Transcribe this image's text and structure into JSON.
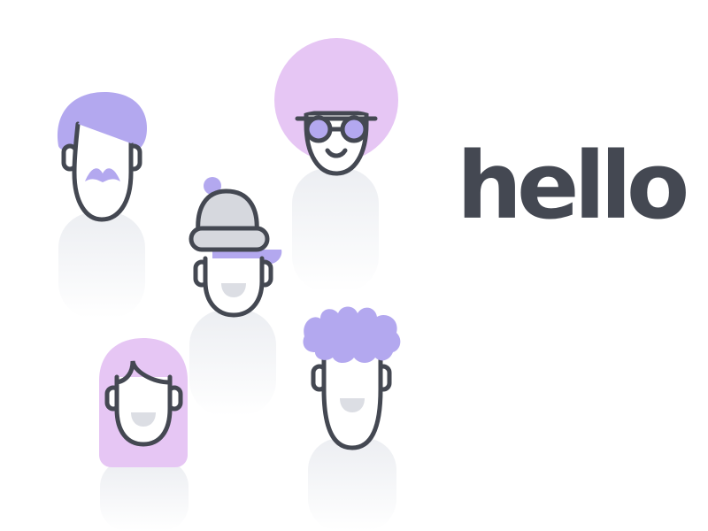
{
  "greeting": {
    "text": "hello"
  },
  "colors": {
    "outline": "#444852",
    "hair_violet": "#b3a8ef",
    "hair_pink": "#e6c6f4",
    "hat_gray": "#d6d8de",
    "mouth_fill": "#dcdee4",
    "shadow": "#eef0f3",
    "text": "#444852",
    "background": "#ffffff"
  },
  "characters": [
    {
      "name": "mustache-man",
      "hair": "violet-swoop",
      "facial_hair": "mustache"
    },
    {
      "name": "afro-glasses-person",
      "hair": "pink-afro",
      "accessory": "round-glasses"
    },
    {
      "name": "beanie-person",
      "hair": "violet-fringe",
      "accessory": "beanie-hat"
    },
    {
      "name": "long-hair-person",
      "hair": "pink-long"
    },
    {
      "name": "curly-hair-person",
      "hair": "violet-curly"
    }
  ]
}
